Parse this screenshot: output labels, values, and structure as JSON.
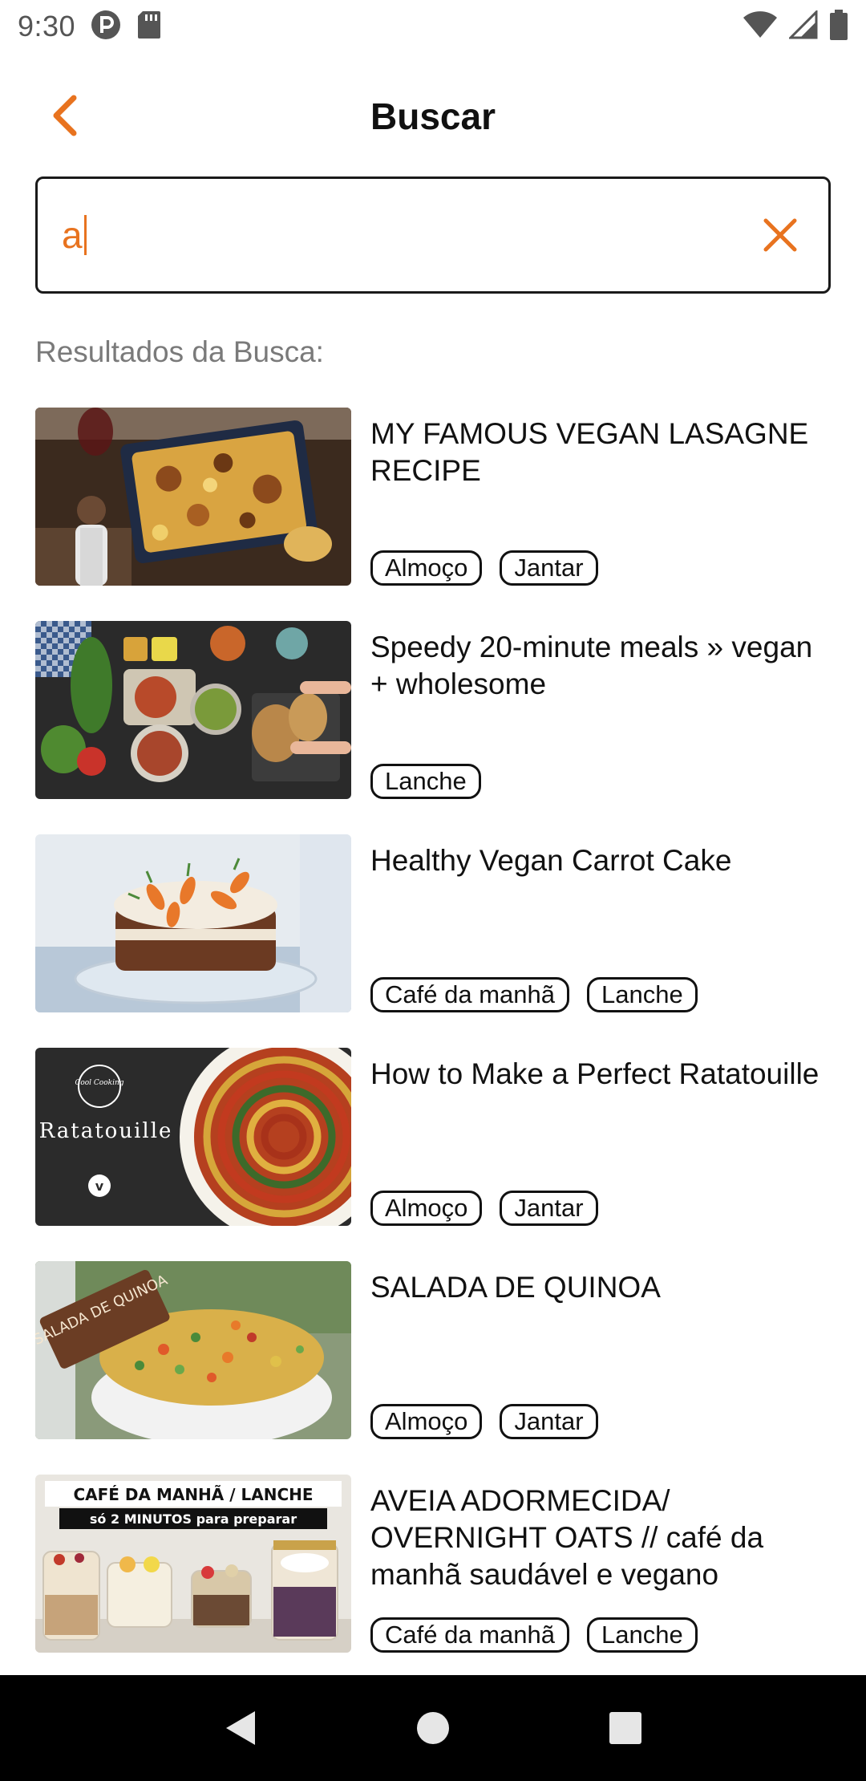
{
  "status_bar": {
    "time": "9:30",
    "icons": [
      "p-circle-icon",
      "sd-card-icon",
      "wifi-icon",
      "signal-icon",
      "battery-icon"
    ]
  },
  "header": {
    "title": "Buscar",
    "back_icon": "chevron-left-icon"
  },
  "search": {
    "value": "a",
    "clear_icon": "close-icon"
  },
  "results_label": "Resultados da Busca:",
  "results": [
    {
      "title": "MY FAMOUS VEGAN LASAGNE RECIPE",
      "tags": [
        "Almoço",
        "Jantar"
      ]
    },
    {
      "title": "Speedy 20-minute meals » vegan + wholesome",
      "tags": [
        "Lanche"
      ]
    },
    {
      "title": "Healthy Vegan Carrot Cake",
      "tags": [
        "Café da manhã",
        "Lanche"
      ]
    },
    {
      "title": "How to Make a Perfect Ratatouille",
      "tags": [
        "Almoço",
        "Jantar"
      ]
    },
    {
      "title": "SALADA DE QUINOA",
      "tags": [
        "Almoço",
        "Jantar"
      ]
    },
    {
      "title": "AVEIA ADORMECIDA/ OVERNIGHT OATS // café da manhã saudável e vegano",
      "tags": [
        "Café da manhã",
        "Lanche"
      ]
    }
  ],
  "thumbnails": {
    "ratatouille_brand": "Cool Cooking",
    "ratatouille_text": "Ratatouille",
    "ratatouille_badge": "v",
    "quinoa_sign": "SALADA DE QUINOA",
    "oats_banner_line1": "CAFÉ DA MANHÃ / LANCHE",
    "oats_banner_line2": "só 2 MINUTOS para preparar"
  },
  "colors": {
    "accent": "#E8731F",
    "text": "#111111",
    "muted": "#7A7A7A",
    "nav_bar": "#000000"
  },
  "nav": {
    "back": "nav-back-icon",
    "home": "nav-home-icon",
    "recents": "nav-recents-icon"
  }
}
